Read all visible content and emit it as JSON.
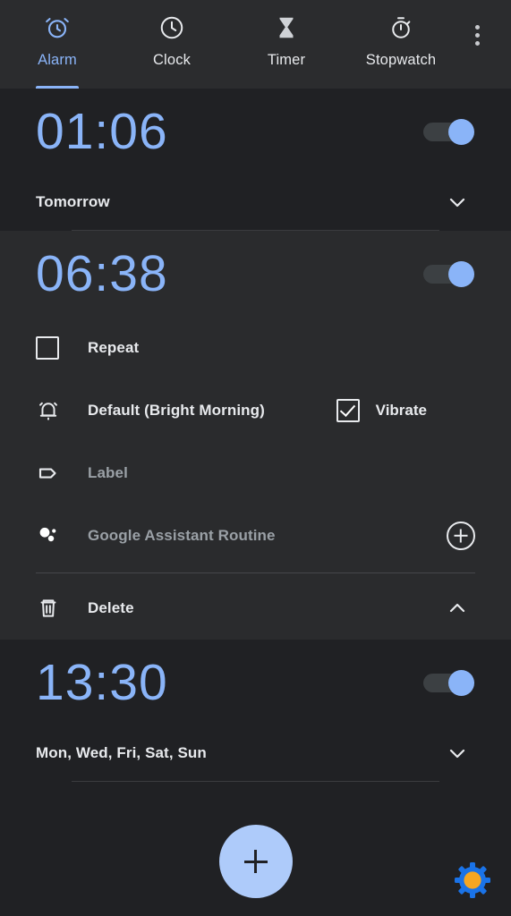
{
  "app": {
    "name": "Clock",
    "theme": "dark",
    "accent_color": "#8ab4f8",
    "background_color": "#202124"
  },
  "tabs": [
    {
      "label": "Alarm",
      "icon": "alarm-clock-icon",
      "active": true
    },
    {
      "label": "Clock",
      "icon": "clock-icon",
      "active": false
    },
    {
      "label": "Timer",
      "icon": "hourglass-icon",
      "active": false
    },
    {
      "label": "Stopwatch",
      "icon": "stopwatch-icon",
      "active": false
    }
  ],
  "overflow_menu": {
    "icon": "more-vertical-icon",
    "label": "More options"
  },
  "alarms": [
    {
      "time": "01:06",
      "days": "Tomorrow",
      "enabled": true,
      "expanded": false,
      "expand_icon": "chevron-down-icon"
    },
    {
      "time": "06:38",
      "days": "",
      "enabled": true,
      "expanded": true,
      "expand_icon": "chevron-up-icon",
      "repeat": {
        "label": "Repeat",
        "checked": false
      },
      "ringtone": {
        "label": "Default (Bright Morning)",
        "icon": "bell-icon"
      },
      "vibrate": {
        "label": "Vibrate",
        "checked": true
      },
      "alarm_label": {
        "label": "Label",
        "icon": "tag-icon",
        "empty": true
      },
      "assistant_routine": {
        "label": "Google Assistant Routine",
        "icon": "google-assistant-icon",
        "add_icon": "plus-circle-icon"
      },
      "delete": {
        "label": "Delete",
        "icon": "trash-icon"
      }
    },
    {
      "time": "13:30",
      "days": "Mon, Wed, Fri, Sat, Sun",
      "enabled": true,
      "expanded": false,
      "expand_icon": "chevron-down-icon"
    }
  ],
  "fab": {
    "label": "+",
    "icon": "plus-icon",
    "color": "#aecbfa"
  },
  "gear_badge": {
    "icon": "gear-icon",
    "outer_color": "#1a73e8",
    "inner_color": "#f5a623"
  }
}
